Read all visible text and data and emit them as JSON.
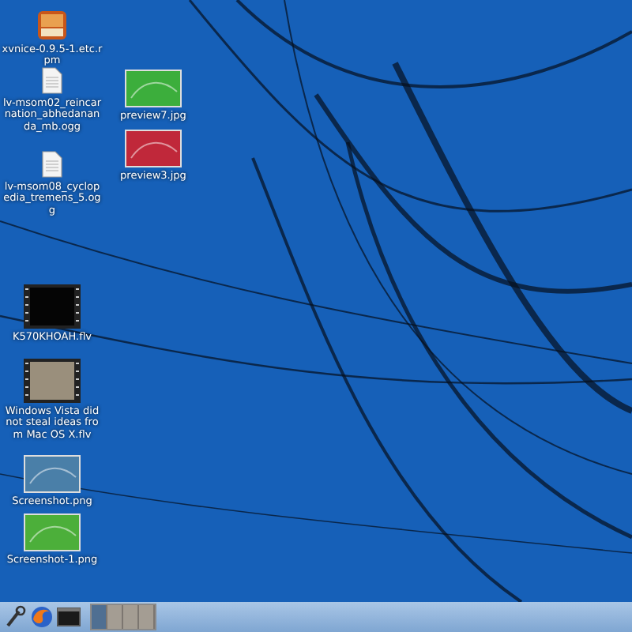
{
  "desktop": {
    "icons": [
      {
        "label": "xvnice-0.9.5-1.etc.rpm",
        "kind": "package"
      },
      {
        "label": "lv-msom02_reincarnation_abhedananda_mb.ogg",
        "kind": "document"
      },
      {
        "label": "lv-msom08_cyclopedia_tremens_5.ogg",
        "kind": "document"
      },
      {
        "label": "preview7.jpg",
        "kind": "thumbnail",
        "color": "#3cae3c"
      },
      {
        "label": "preview3.jpg",
        "kind": "thumbnail",
        "color": "#c0283a"
      },
      {
        "label": "K570KHOAH.flv",
        "kind": "video",
        "color": "#050505"
      },
      {
        "label": "Windows Vista did not steal ideas from Mac OS X.flv",
        "kind": "video",
        "color": "#9a8f7c"
      },
      {
        "label": "Screenshot.png",
        "kind": "thumbnail",
        "color": "#4a7fa8"
      },
      {
        "label": "Screenshot-1.png",
        "kind": "thumbnail",
        "color": "#4caf3a"
      }
    ]
  },
  "taskbar": {
    "launchers": [
      {
        "kind": "tools"
      },
      {
        "kind": "browser"
      },
      {
        "kind": "terminal"
      }
    ],
    "workspaces": [
      {
        "selected": true
      },
      {
        "selected": false
      },
      {
        "selected": false
      },
      {
        "selected": false
      }
    ]
  }
}
